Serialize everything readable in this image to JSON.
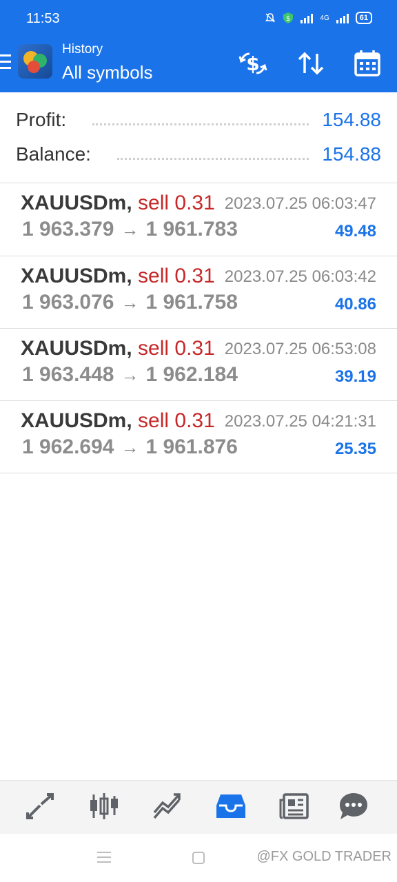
{
  "status_bar": {
    "time": "11:53",
    "network": "4G",
    "battery": "61"
  },
  "app_bar": {
    "title": "History",
    "subtitle": "All symbols"
  },
  "summary": {
    "profit_label": "Profit:",
    "profit_value": "154.88",
    "balance_label": "Balance:",
    "balance_value": "154.88"
  },
  "trades": [
    {
      "symbol": "XAUUSDm,",
      "side": "sell 0.31",
      "time": "2023.07.25 06:03:47",
      "open_price": "1 963.379",
      "arrow": "→",
      "close_price": "1 961.783",
      "profit": "49.48"
    },
    {
      "symbol": "XAUUSDm,",
      "side": "sell 0.31",
      "time": "2023.07.25 06:03:42",
      "open_price": "1 963.076",
      "arrow": "→",
      "close_price": "1 961.758",
      "profit": "40.86"
    },
    {
      "symbol": "XAUUSDm,",
      "side": "sell 0.31",
      "time": "2023.07.25 06:53:08",
      "open_price": "1 963.448",
      "arrow": "→",
      "close_price": "1 962.184",
      "profit": "39.19"
    },
    {
      "symbol": "XAUUSDm,",
      "side": "sell 0.31",
      "time": "2023.07.25 04:21:31",
      "open_price": "1 962.694",
      "arrow": "→",
      "close_price": "1 961.876",
      "profit": "25.35"
    }
  ],
  "bottom_nav": {
    "items": [
      "quotes-icon",
      "chart-candles-icon",
      "trade-icon",
      "history-icon",
      "news-icon",
      "messages-icon"
    ],
    "active": "history-icon"
  },
  "watermark": "@FX GOLD TRADER",
  "colors": {
    "primary": "#1a73e8",
    "sell": "#c62828",
    "muted": "#8c8c8c"
  }
}
